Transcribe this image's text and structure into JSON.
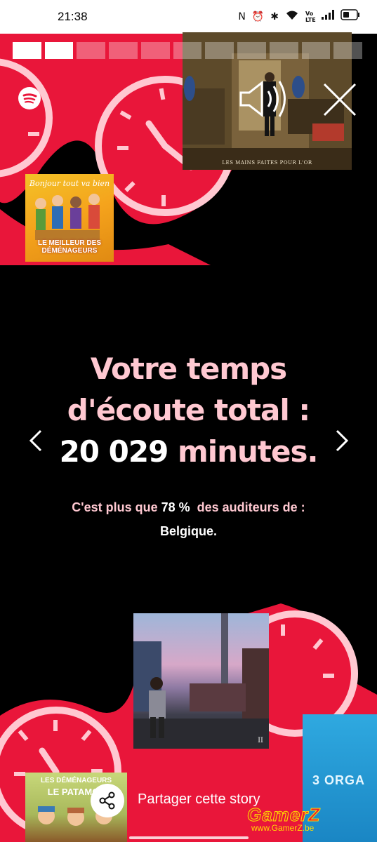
{
  "status_bar": {
    "time": "21:38",
    "icons": [
      "nfc-icon",
      "alarm-icon",
      "bluetooth-icon",
      "wifi-icon",
      "volte-icon",
      "signal-icon",
      "battery-icon"
    ],
    "volte_label": "Vo LTE"
  },
  "story": {
    "progress_total": 11,
    "progress_completed": 2
  },
  "video": {
    "caption": "LES MAINS FAITES POUR L'OR"
  },
  "albums": {
    "cover1": {
      "title": "Bonjour tout va bien",
      "subtitle": "LE MEILLEUR DES DÉMÉNAGEURS"
    },
    "cover2": {
      "label": "II"
    },
    "cover3": {
      "label": "3 ORGA"
    },
    "cover4": {
      "title": "LES DÉMÉNAGEURS",
      "subtitle": "LE PATAMOT"
    }
  },
  "headline": {
    "line1": "Votre temps",
    "line2": "d'écoute total :",
    "minutes_value": "20 029",
    "minutes_label": "minutes."
  },
  "subtext": {
    "prefix": "C'est plus que ",
    "percent": "78 %",
    "suffix": "  des auditeurs de :",
    "country": "Belgique."
  },
  "share": {
    "label": "Partager cette story"
  },
  "watermark": {
    "title": "GamerZ",
    "url": "www.GamerZ.be"
  },
  "colors": {
    "accent_red": "#e9163a",
    "pink_text": "#ffc8d1",
    "background": "#000000"
  }
}
